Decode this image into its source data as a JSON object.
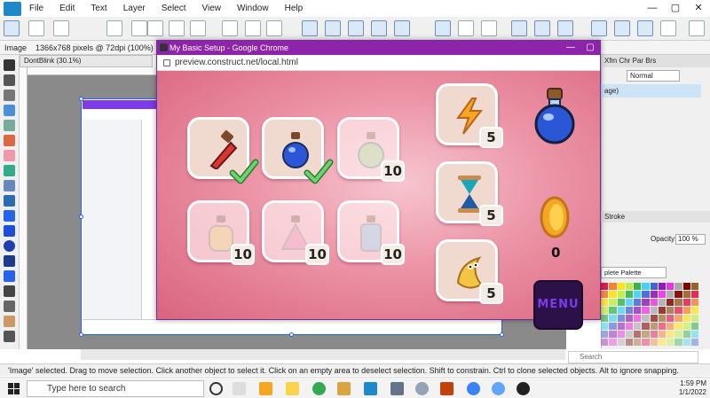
{
  "menubar": {
    "items": [
      "File",
      "Edit",
      "Text",
      "Layer",
      "Select",
      "View",
      "Window",
      "Help"
    ],
    "controls": [
      "—",
      "▢",
      "✕"
    ]
  },
  "context_bar": {
    "selection_label": "Image",
    "image_info": "1366x768 pixels @ 72dpi (100%)"
  },
  "document_tab": "DontBlink (30.1%)",
  "popup": {
    "title": "My Basic Setup - Google Chrome",
    "url": "preview.construct.net/local.html",
    "controls": [
      "—",
      "▢"
    ]
  },
  "game": {
    "potions": [
      {
        "name": "red-potion",
        "state": "collected",
        "count": ""
      },
      {
        "name": "blue-potion",
        "state": "collected",
        "count": ""
      },
      {
        "name": "green-potion",
        "state": "locked",
        "count": "10"
      },
      {
        "name": "yellow-potion",
        "state": "locked",
        "count": "10"
      },
      {
        "name": "pink-potion",
        "state": "locked",
        "count": "10"
      },
      {
        "name": "cyan-potion",
        "state": "locked",
        "count": "10"
      }
    ],
    "powerups": [
      {
        "name": "lightning",
        "count": "5"
      },
      {
        "name": "hourglass",
        "count": "5"
      },
      {
        "name": "banana-monster",
        "count": "5"
      }
    ],
    "coin_count": "0",
    "menu_label": "MENU"
  },
  "right_panel": {
    "tabs": "Xfm  Chr  Par  Brs",
    "blend_mode": "Normal",
    "layer_name": "age)",
    "stroke_label": "Stroke",
    "opacity_label": "Opacity:",
    "opacity_value": "100 %",
    "palette_name": "plete Palette",
    "search_placeholder": "Search"
  },
  "status_bar": {
    "text": "'Image' selected. Drag to move selection. Click another object to select it. Click on an empty area to deselect selection. Shift to constrain. Ctrl to clone selected objects. Alt to ignore snapping."
  },
  "taskbar": {
    "search_placeholder": "Type here to search",
    "time": "1:59 PM",
    "date": "1/1/2022"
  },
  "colors": {
    "popup_title": "#8e24aa",
    "game_pink": "#ec93a6",
    "selection_blue": "#2563eb"
  }
}
